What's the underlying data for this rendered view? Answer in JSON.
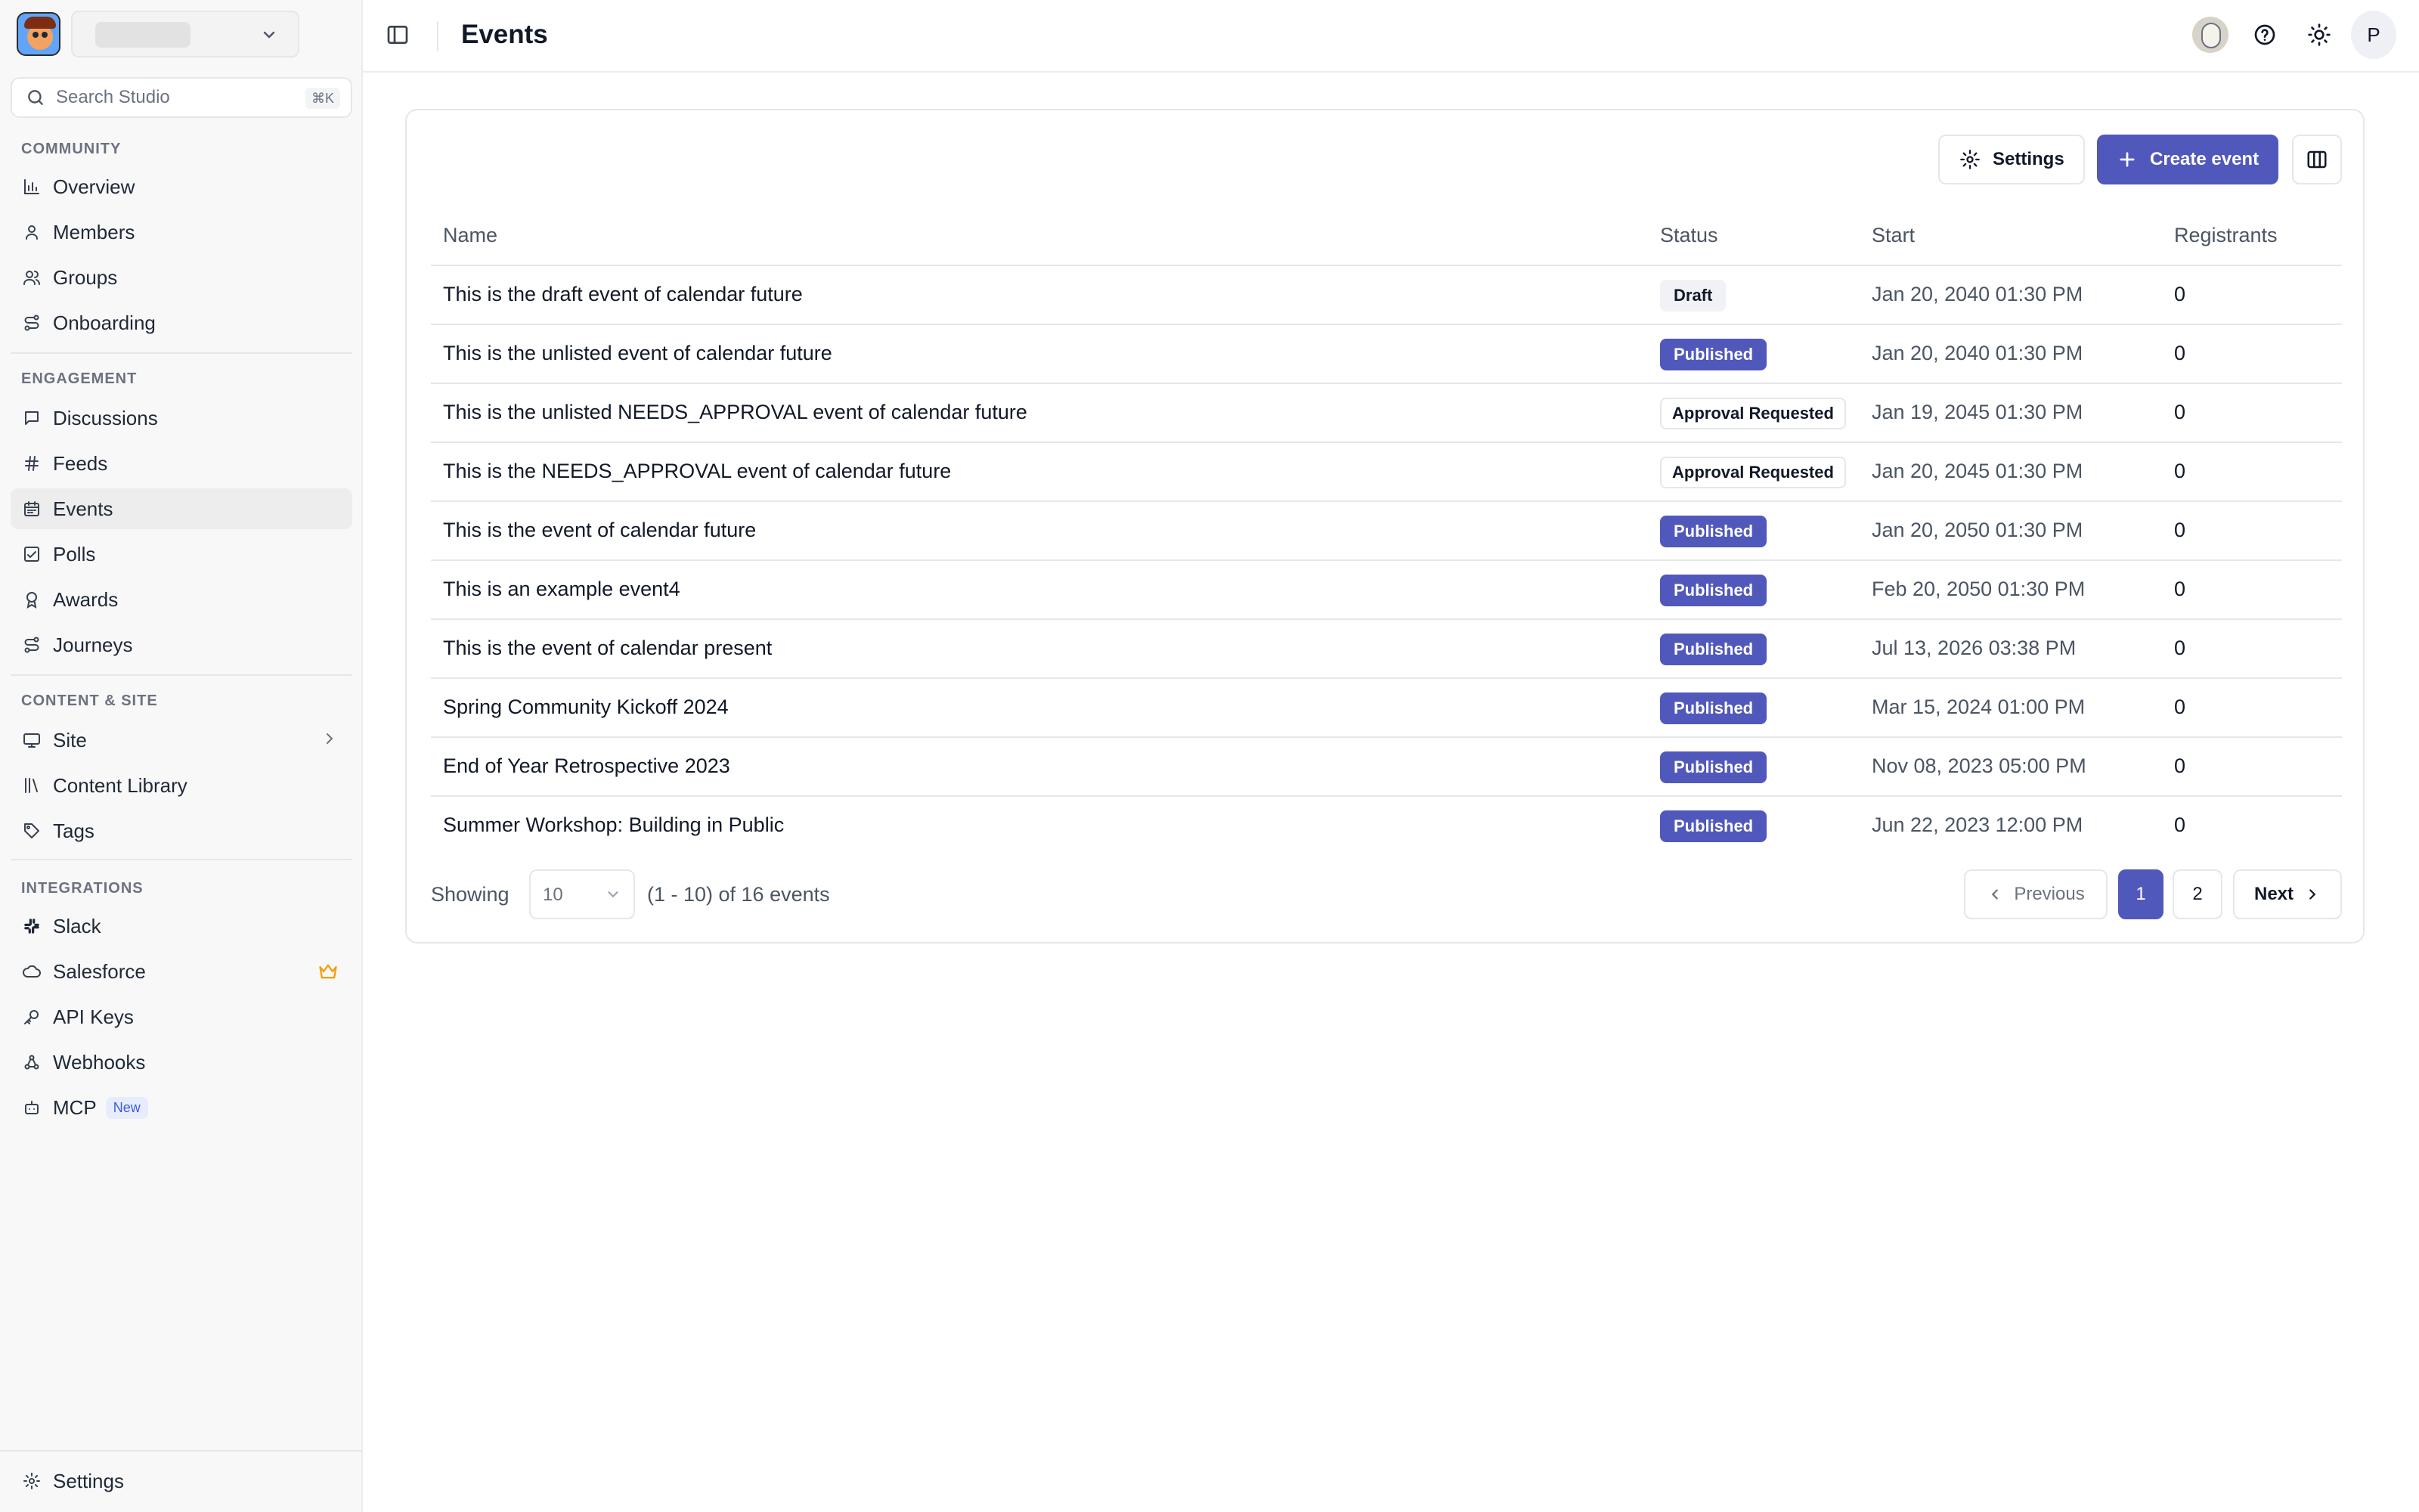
{
  "sidebar": {
    "search": {
      "placeholder": "Search Studio",
      "shortcut": "⌘K"
    },
    "sections": [
      {
        "title": "COMMUNITY",
        "items": [
          {
            "label": "Overview",
            "icon": "bar-chart-icon"
          },
          {
            "label": "Members",
            "icon": "user-icon"
          },
          {
            "label": "Groups",
            "icon": "users-icon"
          },
          {
            "label": "Onboarding",
            "icon": "route-icon"
          }
        ]
      },
      {
        "title": "ENGAGEMENT",
        "items": [
          {
            "label": "Discussions",
            "icon": "message-icon"
          },
          {
            "label": "Feeds",
            "icon": "hash-icon"
          },
          {
            "label": "Events",
            "icon": "calendar-icon",
            "active": true
          },
          {
            "label": "Polls",
            "icon": "poll-icon"
          },
          {
            "label": "Awards",
            "icon": "award-icon"
          },
          {
            "label": "Journeys",
            "icon": "route-icon"
          }
        ]
      },
      {
        "title": "CONTENT & SITE",
        "items": [
          {
            "label": "Site",
            "icon": "monitor-icon"
          },
          {
            "label": "Content Library",
            "icon": "library-icon"
          },
          {
            "label": "Tags",
            "icon": "tag-icon"
          }
        ]
      },
      {
        "title": "INTEGRATIONS",
        "items": [
          {
            "label": "Slack",
            "icon": "slack-icon"
          },
          {
            "label": "Salesforce",
            "icon": "cloud-icon"
          },
          {
            "label": "API Keys",
            "icon": "key-icon"
          },
          {
            "label": "Webhooks",
            "icon": "webhook-icon"
          },
          {
            "label": "MCP",
            "icon": "bot-icon",
            "badge": "New"
          }
        ]
      }
    ],
    "footer": {
      "label": "Settings",
      "icon": "gear-icon"
    }
  },
  "header": {
    "title": "Events"
  },
  "toolbar": {
    "settings_label": "Settings",
    "create_label": "Create event"
  },
  "table": {
    "columns": [
      "Name",
      "Status",
      "Start",
      "Registrants"
    ],
    "rows": [
      {
        "name": "This is the draft event of calendar future",
        "status": "Draft",
        "start": "Jan 20, 2040 01:30 PM",
        "registrants": "0"
      },
      {
        "name": "This is the unlisted event of calendar future",
        "status": "Published",
        "start": "Jan 20, 2040 01:30 PM",
        "registrants": "0"
      },
      {
        "name": "This is the unlisted NEEDS_APPROVAL event of calendar future",
        "status": "Approval Requested",
        "start": "Jan 19, 2045 01:30 PM",
        "registrants": "0"
      },
      {
        "name": "This is the NEEDS_APPROVAL event of calendar future",
        "status": "Approval Requested",
        "start": "Jan 20, 2045 01:30 PM",
        "registrants": "0"
      },
      {
        "name": "This is the event of calendar future",
        "status": "Published",
        "start": "Jan 20, 2050 01:30 PM",
        "registrants": "0"
      },
      {
        "name": "This is an example event4",
        "status": "Published",
        "start": "Feb 20, 2050 01:30 PM",
        "registrants": "0"
      },
      {
        "name": "This is the event of calendar present",
        "status": "Published",
        "start": "Jul 13, 2026 03:38 PM",
        "registrants": "0"
      },
      {
        "name": "Spring Community Kickoff 2024",
        "status": "Published",
        "start": "Mar 15, 2024 01:00 PM",
        "registrants": "0"
      },
      {
        "name": "End of Year Retrospective 2023",
        "status": "Published",
        "start": "Nov 08, 2023 05:00 PM",
        "registrants": "0"
      },
      {
        "name": "Summer Workshop: Building in Public",
        "status": "Published",
        "start": "Jun 22, 2023 12:00 PM",
        "registrants": "0"
      }
    ]
  },
  "pagination": {
    "showing_label": "Showing",
    "page_size": "10",
    "range_text": "(1 - 10) of 16 events",
    "previous_label": "Previous",
    "pages": [
      "1",
      "2"
    ],
    "current_page": "1",
    "next_label": "Next"
  },
  "header_user": {
    "initial": "P"
  },
  "colors": {
    "accent": "#5158bb",
    "crown": "#f59e0b",
    "new_badge": "#3b5bdb"
  }
}
